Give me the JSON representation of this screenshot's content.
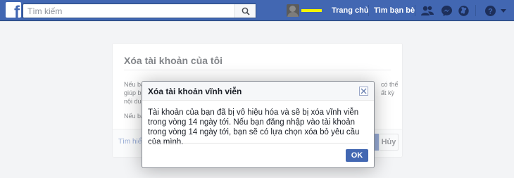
{
  "header": {
    "logo_letter": "f",
    "search_placeholder": "Tìm kiếm",
    "nav": {
      "home": "Trang chủ",
      "find_friends": "Tìm bạn bè"
    },
    "icons": [
      "friend-requests-icon",
      "messenger-icon",
      "globe-icon",
      "help-icon",
      "dropdown-icon"
    ]
  },
  "card": {
    "title": "Xóa tài khoản của tôi",
    "text_lines": [
      "Nếu bạ",
      "giúp bạ",
      "nội dun"
    ],
    "text_right": [
      "có thể",
      "ất kỳ"
    ],
    "text_2": "Nếu bạ",
    "footer_link": "Tìm hiể",
    "cancel_label": "Hủy"
  },
  "dialog": {
    "title": "Xóa tài khoản vĩnh viễn",
    "body": "Tài khoản của bạn đã bị vô hiệu hóa và sẽ bị xóa vĩnh viễn trong vòng 14 ngày tới. Nếu bạn đăng nhập vào tài khoản trong vòng 14 ngày tới, bạn sẽ có lựa chọn xóa bỏ yêu cầu của mình.",
    "ok_label": "OK"
  },
  "colors": {
    "brand": "#4267b2",
    "page_bg": "#e9ebee"
  }
}
